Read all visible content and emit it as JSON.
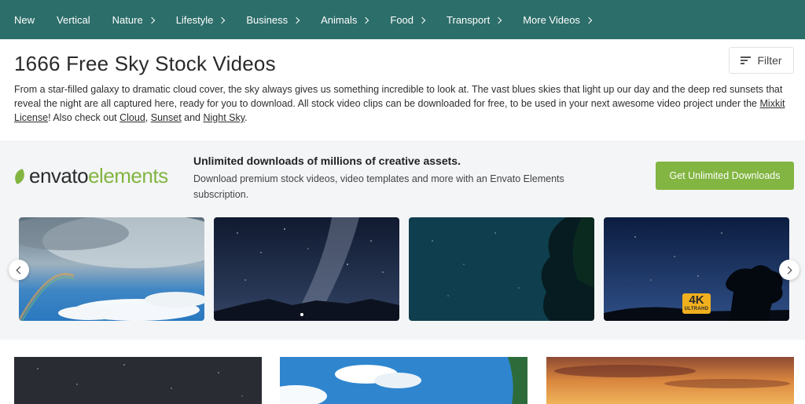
{
  "nav": {
    "items": [
      {
        "label": "New",
        "chevron": false
      },
      {
        "label": "Vertical",
        "chevron": false
      },
      {
        "label": "Nature",
        "chevron": true
      },
      {
        "label": "Lifestyle",
        "chevron": true
      },
      {
        "label": "Business",
        "chevron": true
      },
      {
        "label": "Animals",
        "chevron": true
      },
      {
        "label": "Food",
        "chevron": true
      },
      {
        "label": "Transport",
        "chevron": true
      },
      {
        "label": "More Videos",
        "chevron": true
      }
    ]
  },
  "header": {
    "title": "1666 Free Sky Stock Videos",
    "filter_label": "Filter"
  },
  "intro": {
    "text_1": "From a star-filled galaxy to dramatic cloud cover, the sky always gives us something incredible to look at. The vast blues skies that light up our day and the deep red sunsets that reveal the night are all captured here, ready for you to download. All stock video clips can be downloaded for free, to be used in your next awesome video project under the ",
    "license_link": "Mixkit License",
    "text_2": "! Also check out ",
    "link_cloud": "Cloud",
    "sep_1": ", ",
    "link_sunset": "Sunset",
    "sep_2": " and ",
    "link_night_sky": "Night Sky",
    "text_3": "."
  },
  "banner": {
    "logo_part_1": "envato",
    "logo_part_2": "elements",
    "title": "Unlimited downloads of millions of creative assets.",
    "subtitle": "Download premium stock videos, video templates and more with an Envato Elements subscription.",
    "cta_label": "Get Unlimited Downloads",
    "badge_big": "4K",
    "badge_small": "ULTRAHD"
  },
  "colors": {
    "nav_bg": "#2c6e6a",
    "envato_green": "#82b541",
    "badge_yellow": "#f2b01e",
    "banner_bg": "#f4f5f7"
  },
  "icons": {
    "filter": "filter-lines-icon",
    "carousel_prev": "chevron-left-icon",
    "carousel_next": "chevron-right-icon",
    "nav_chevron": "chevron-right-icon",
    "logo_leaf": "envato-leaf-icon"
  }
}
